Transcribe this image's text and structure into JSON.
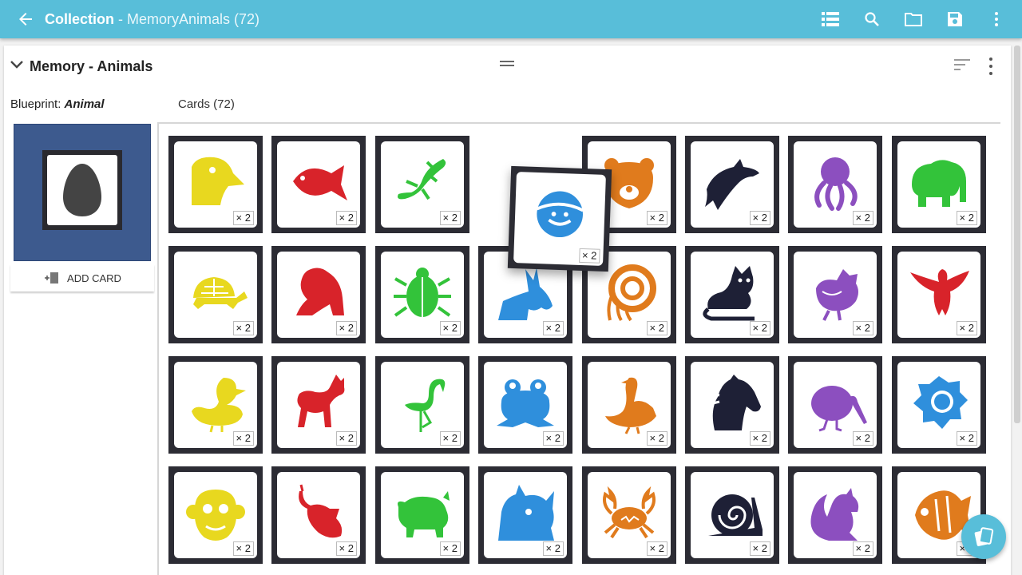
{
  "appbar": {
    "title": "Collection",
    "subtitle": " - MemoryAnimals (72)",
    "icons": [
      "back-arrow-icon",
      "list-view-icon",
      "search-icon",
      "folder-icon",
      "save-icon",
      "more-vert-icon"
    ]
  },
  "panel": {
    "title": "Memory - Animals",
    "blueprint_prefix": "Blueprint: ",
    "blueprint_name": "Animal",
    "cards_label": "Cards (72)",
    "add_card_label": "ADD CARD"
  },
  "colors": {
    "appbar": "#58bed9",
    "card_frame": "#2c2c34",
    "blueprint_bg": "#3d5a8e",
    "yellow": "#e8d81f",
    "red": "#d8232a",
    "green": "#33c33a",
    "orange": "#e07b1d",
    "navy": "#1e2036",
    "purple": "#8c4fbf",
    "blue": "#2f8fdc"
  },
  "count_prefix": "× ",
  "cards": [
    {
      "animal": "bird-head",
      "color": "yellow",
      "count": "2"
    },
    {
      "animal": "fish",
      "color": "red",
      "count": "2"
    },
    {
      "animal": "lizard",
      "color": "green",
      "count": "2"
    },
    {
      "animal": "empty-slot",
      "color": "none",
      "count": ""
    },
    {
      "animal": "bear",
      "color": "orange",
      "count": "2"
    },
    {
      "animal": "dolphin",
      "color": "navy",
      "count": "2"
    },
    {
      "animal": "octopus",
      "color": "purple",
      "count": "2"
    },
    {
      "animal": "elephant",
      "color": "green",
      "count": "2"
    },
    {
      "animal": "turtle",
      "color": "yellow",
      "count": "2"
    },
    {
      "animal": "gorilla",
      "color": "red",
      "count": "2"
    },
    {
      "animal": "beetle",
      "color": "green",
      "count": "2"
    },
    {
      "animal": "donkey",
      "color": "blue",
      "count": "2"
    },
    {
      "animal": "ammonite",
      "color": "orange",
      "count": "2"
    },
    {
      "animal": "cat",
      "color": "navy",
      "count": "2"
    },
    {
      "animal": "chicken",
      "color": "purple",
      "count": "2"
    },
    {
      "animal": "eagle",
      "color": "red",
      "count": "2"
    },
    {
      "animal": "duck",
      "color": "yellow",
      "count": "2"
    },
    {
      "animal": "cat-walking",
      "color": "red",
      "count": "2"
    },
    {
      "animal": "flamingo",
      "color": "green",
      "count": "2"
    },
    {
      "animal": "frog",
      "color": "blue",
      "count": "2"
    },
    {
      "animal": "goose",
      "color": "orange",
      "count": "2"
    },
    {
      "animal": "horse-head",
      "color": "navy",
      "count": "2"
    },
    {
      "animal": "kiwi",
      "color": "purple",
      "count": "2"
    },
    {
      "animal": "lion",
      "color": "blue",
      "count": "2"
    },
    {
      "animal": "monkey",
      "color": "yellow",
      "count": "2"
    },
    {
      "animal": "mouse",
      "color": "red",
      "count": "2"
    },
    {
      "animal": "pig",
      "color": "green",
      "count": "2"
    },
    {
      "animal": "rhino",
      "color": "blue",
      "count": "2"
    },
    {
      "animal": "crab",
      "color": "orange",
      "count": "2"
    },
    {
      "animal": "snail",
      "color": "navy",
      "count": "2"
    },
    {
      "animal": "squirrel",
      "color": "purple",
      "count": "2"
    },
    {
      "animal": "tropical-fish",
      "color": "orange",
      "count": "2"
    }
  ],
  "dragging_card": {
    "animal": "crab-circle",
    "color": "blue",
    "count": "2"
  }
}
